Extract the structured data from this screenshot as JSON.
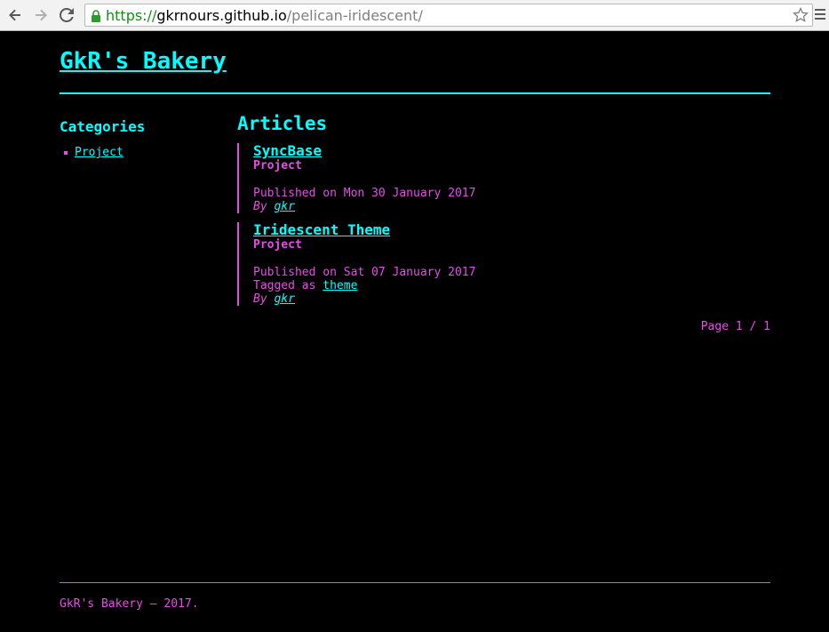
{
  "browser": {
    "url_scheme": "https://",
    "url_host": "gkrnours.github.io",
    "url_path": "/pelican-iridescent/",
    "icons": [
      "back-arrow-icon",
      "forward-arrow-icon",
      "reload-icon",
      "lock-icon",
      "star-icon",
      "menu-icon"
    ]
  },
  "site": {
    "title": "GkR's Bakery"
  },
  "sidebar": {
    "heading": "Categories",
    "categories": [
      "Project"
    ]
  },
  "main": {
    "heading": "Articles",
    "articles": [
      {
        "title": "SyncBase",
        "category": "Project",
        "published": "Published on Mon 30 January 2017",
        "by_prefix": "By",
        "author": "gkr"
      },
      {
        "title": "Iridescent Theme",
        "category": "Project",
        "published": "Published on Sat 07 January 2017",
        "tagged_prefix": "Tagged as",
        "tag": "theme",
        "by_prefix": "By",
        "author": "gkr"
      }
    ],
    "pager": "Page 1 / 1"
  },
  "footer": {
    "text": "GkR's Bakery — 2017."
  },
  "colors": {
    "accent": "#00ffff",
    "secondary": "#e64de6",
    "background": "#000000"
  }
}
